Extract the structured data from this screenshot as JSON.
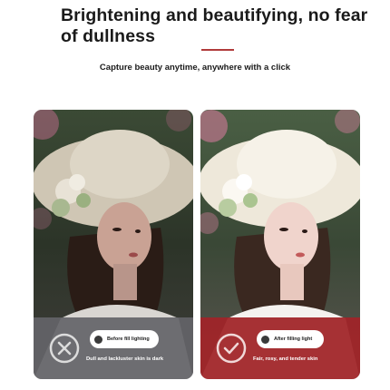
{
  "header": {
    "title": "Brightening and beautifying, no fear of dullness",
    "subtitle": "Capture beauty anytime, anywhere with a click"
  },
  "comparison": {
    "before": {
      "label": "Before fill lighting",
      "caption": "Dull and lackluster skin is dark",
      "icon": "cross-circle-icon"
    },
    "after": {
      "label": "After filling light",
      "caption": "Fair, rosy, and tender skin",
      "icon": "check-circle-icon"
    }
  },
  "colors": {
    "accent": "#b03a3a",
    "before_bar": "#646468",
    "after_bar": "#a02428"
  }
}
